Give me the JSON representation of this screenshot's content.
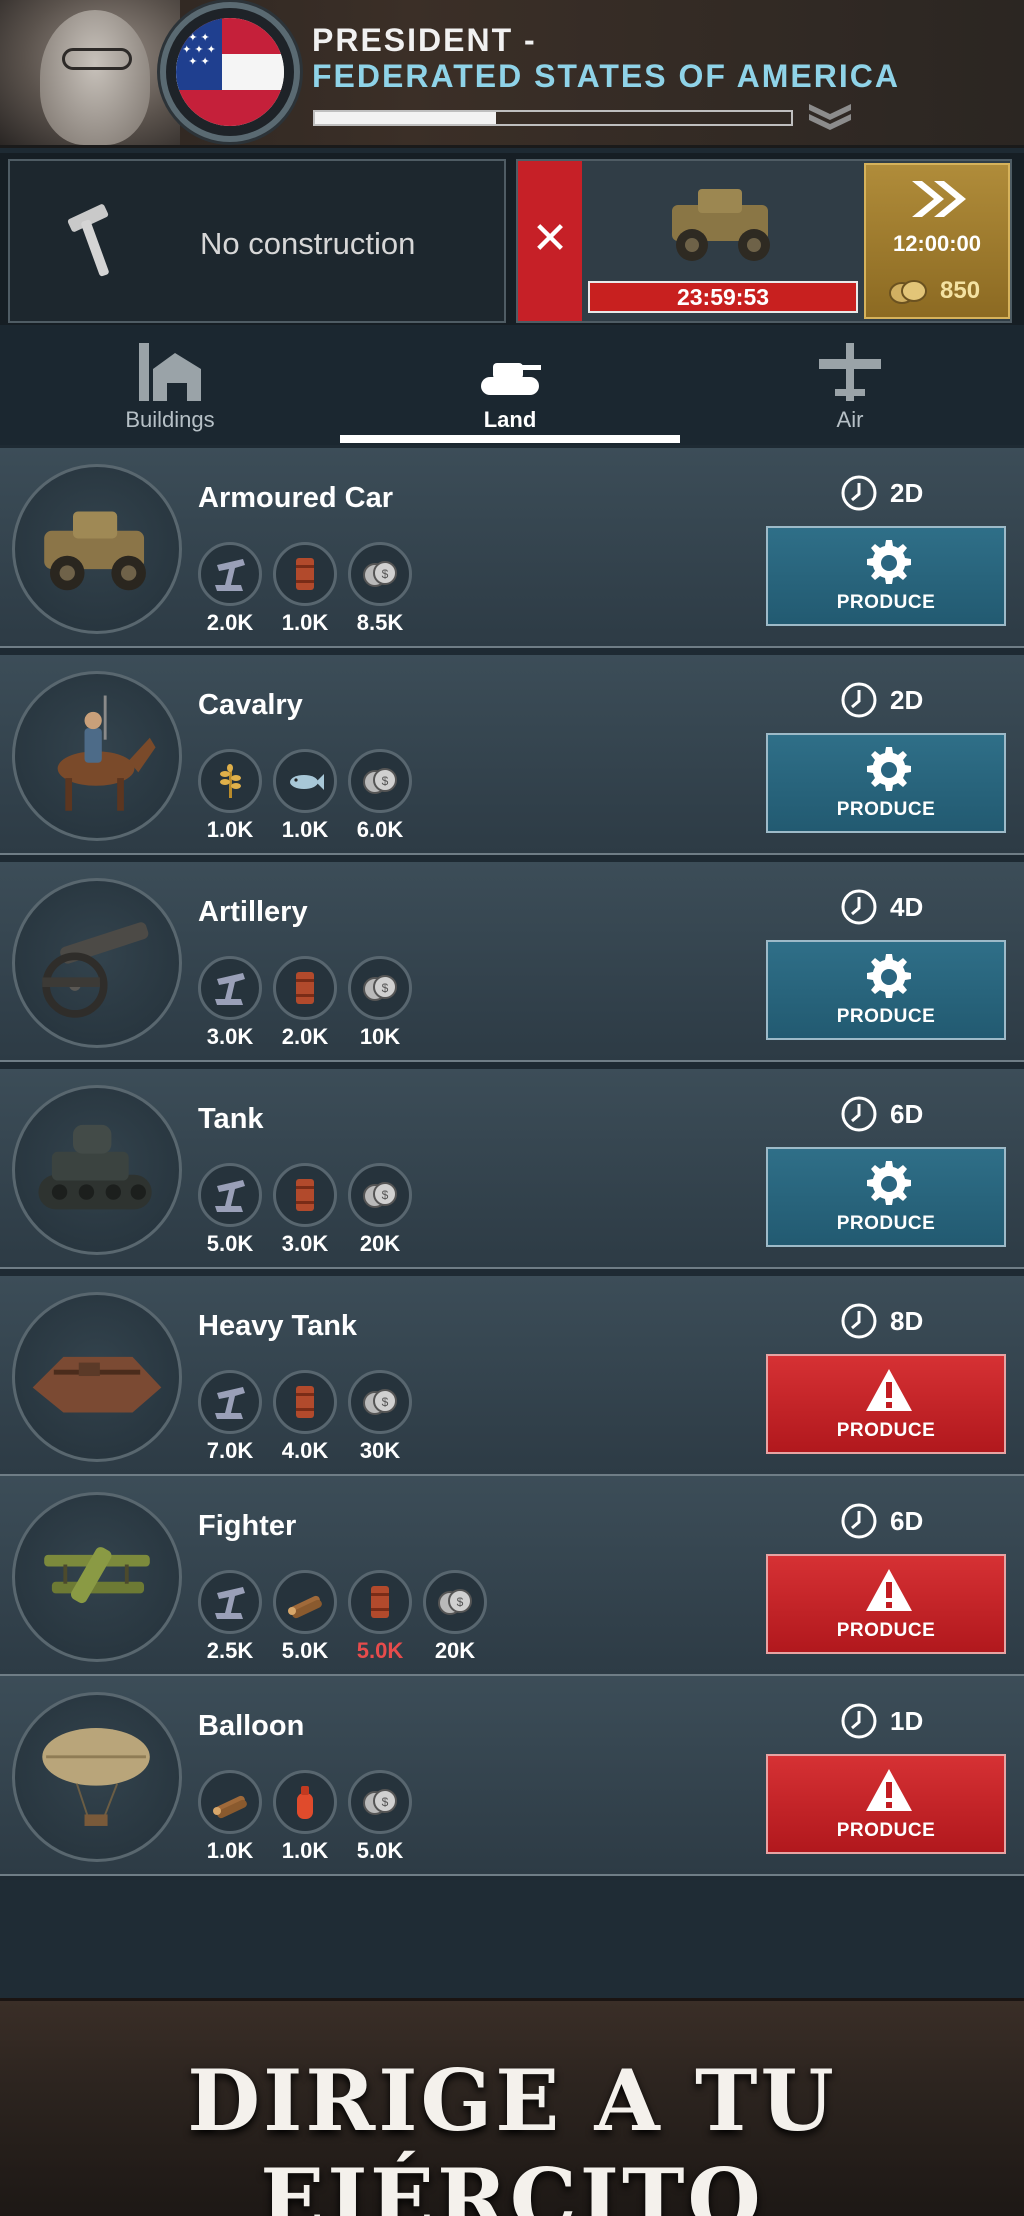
{
  "header": {
    "title_line1": "PRESIDENT -",
    "title_line2": "FEDERATED STATES OF AMERICA",
    "progress": 0.38,
    "flag_colors": {
      "red": "#c5203a",
      "white": "#f5f5f5",
      "blue": "#1f3f8f"
    },
    "accent_color": "#8fd3e8"
  },
  "queue": {
    "construction_label": "No construction",
    "cancel_glyph": "✕",
    "production_timer": "23:59:53",
    "speedup_time": "12:00:00",
    "speedup_cost": "850"
  },
  "tabs": [
    {
      "label": "Buildings",
      "icon": "buildings-icon",
      "active": false
    },
    {
      "label": "Land",
      "icon": "tank-icon",
      "active": true
    },
    {
      "label": "Air",
      "icon": "plane-icon",
      "active": false
    }
  ],
  "units": [
    {
      "name": "Armoured Car",
      "duration": "2D",
      "status": "available",
      "button_label": "PRODUCE",
      "resources": [
        {
          "icon": "steel-icon",
          "amount": "2.0K"
        },
        {
          "icon": "oil-barrel-icon",
          "amount": "1.0K"
        },
        {
          "icon": "money-icon",
          "amount": "8.5K"
        }
      ]
    },
    {
      "name": "Cavalry",
      "duration": "2D",
      "status": "available",
      "button_label": "PRODUCE",
      "resources": [
        {
          "icon": "grain-icon",
          "amount": "1.0K"
        },
        {
          "icon": "fish-icon",
          "amount": "1.0K"
        },
        {
          "icon": "money-icon",
          "amount": "6.0K"
        }
      ]
    },
    {
      "name": "Artillery",
      "duration": "4D",
      "status": "available",
      "button_label": "PRODUCE",
      "resources": [
        {
          "icon": "steel-icon",
          "amount": "3.0K"
        },
        {
          "icon": "oil-barrel-icon",
          "amount": "2.0K"
        },
        {
          "icon": "money-icon",
          "amount": "10K"
        }
      ]
    },
    {
      "name": "Tank",
      "duration": "6D",
      "status": "available",
      "button_label": "PRODUCE",
      "resources": [
        {
          "icon": "steel-icon",
          "amount": "5.0K"
        },
        {
          "icon": "oil-barrel-icon",
          "amount": "3.0K"
        },
        {
          "icon": "money-icon",
          "amount": "20K"
        }
      ]
    },
    {
      "name": "Heavy Tank",
      "duration": "8D",
      "status": "blocked",
      "button_label": "PRODUCE",
      "resources": [
        {
          "icon": "steel-icon",
          "amount": "7.0K"
        },
        {
          "icon": "oil-barrel-icon",
          "amount": "4.0K"
        },
        {
          "icon": "money-icon",
          "amount": "30K"
        }
      ]
    },
    {
      "name": "Fighter",
      "duration": "6D",
      "status": "blocked",
      "button_label": "PRODUCE",
      "resources": [
        {
          "icon": "steel-icon",
          "amount": "2.5K"
        },
        {
          "icon": "wood-icon",
          "amount": "5.0K"
        },
        {
          "icon": "oil-barrel-icon",
          "amount": "5.0K",
          "short": true
        },
        {
          "icon": "money-icon",
          "amount": "20K"
        }
      ]
    },
    {
      "name": "Balloon",
      "duration": "1D",
      "status": "blocked",
      "button_label": "PRODUCE",
      "resources": [
        {
          "icon": "wood-icon",
          "amount": "1.0K"
        },
        {
          "icon": "gas-canister-icon",
          "amount": "1.0K"
        },
        {
          "icon": "money-icon",
          "amount": "5.0K"
        }
      ]
    }
  ],
  "banner": {
    "text": "DIRIGE A TU EJÉRCITO"
  },
  "colors": {
    "produce_blue": "#2f6f88",
    "produce_red": "#c8201f",
    "short_red": "#e74c4c"
  }
}
